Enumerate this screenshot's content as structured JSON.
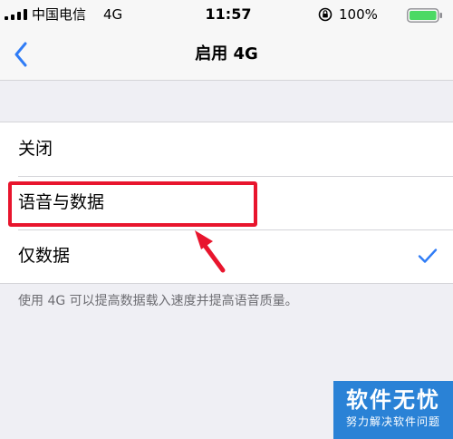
{
  "status_bar": {
    "carrier": "中国电信",
    "network": "4G",
    "time": "11:57",
    "battery_percent": "100%",
    "battery_color": "#4cd964"
  },
  "nav": {
    "back_icon": "chevron-left-icon",
    "title": "启用 4G",
    "accent_color": "#2f7cf6"
  },
  "options": [
    {
      "label": "关闭",
      "selected": false
    },
    {
      "label": "语音与数据",
      "selected": false
    },
    {
      "label": "仅数据",
      "selected": true
    }
  ],
  "footnote": "使用 4G 可以提高数据载入速度并提高语音质量。",
  "annotation": {
    "highlight_color": "#e8152d",
    "highlighted_option": "语音与数据"
  },
  "watermark": {
    "title": "软件无忧",
    "subtitle": "努力解决软件问题",
    "color": "#1978d2"
  }
}
